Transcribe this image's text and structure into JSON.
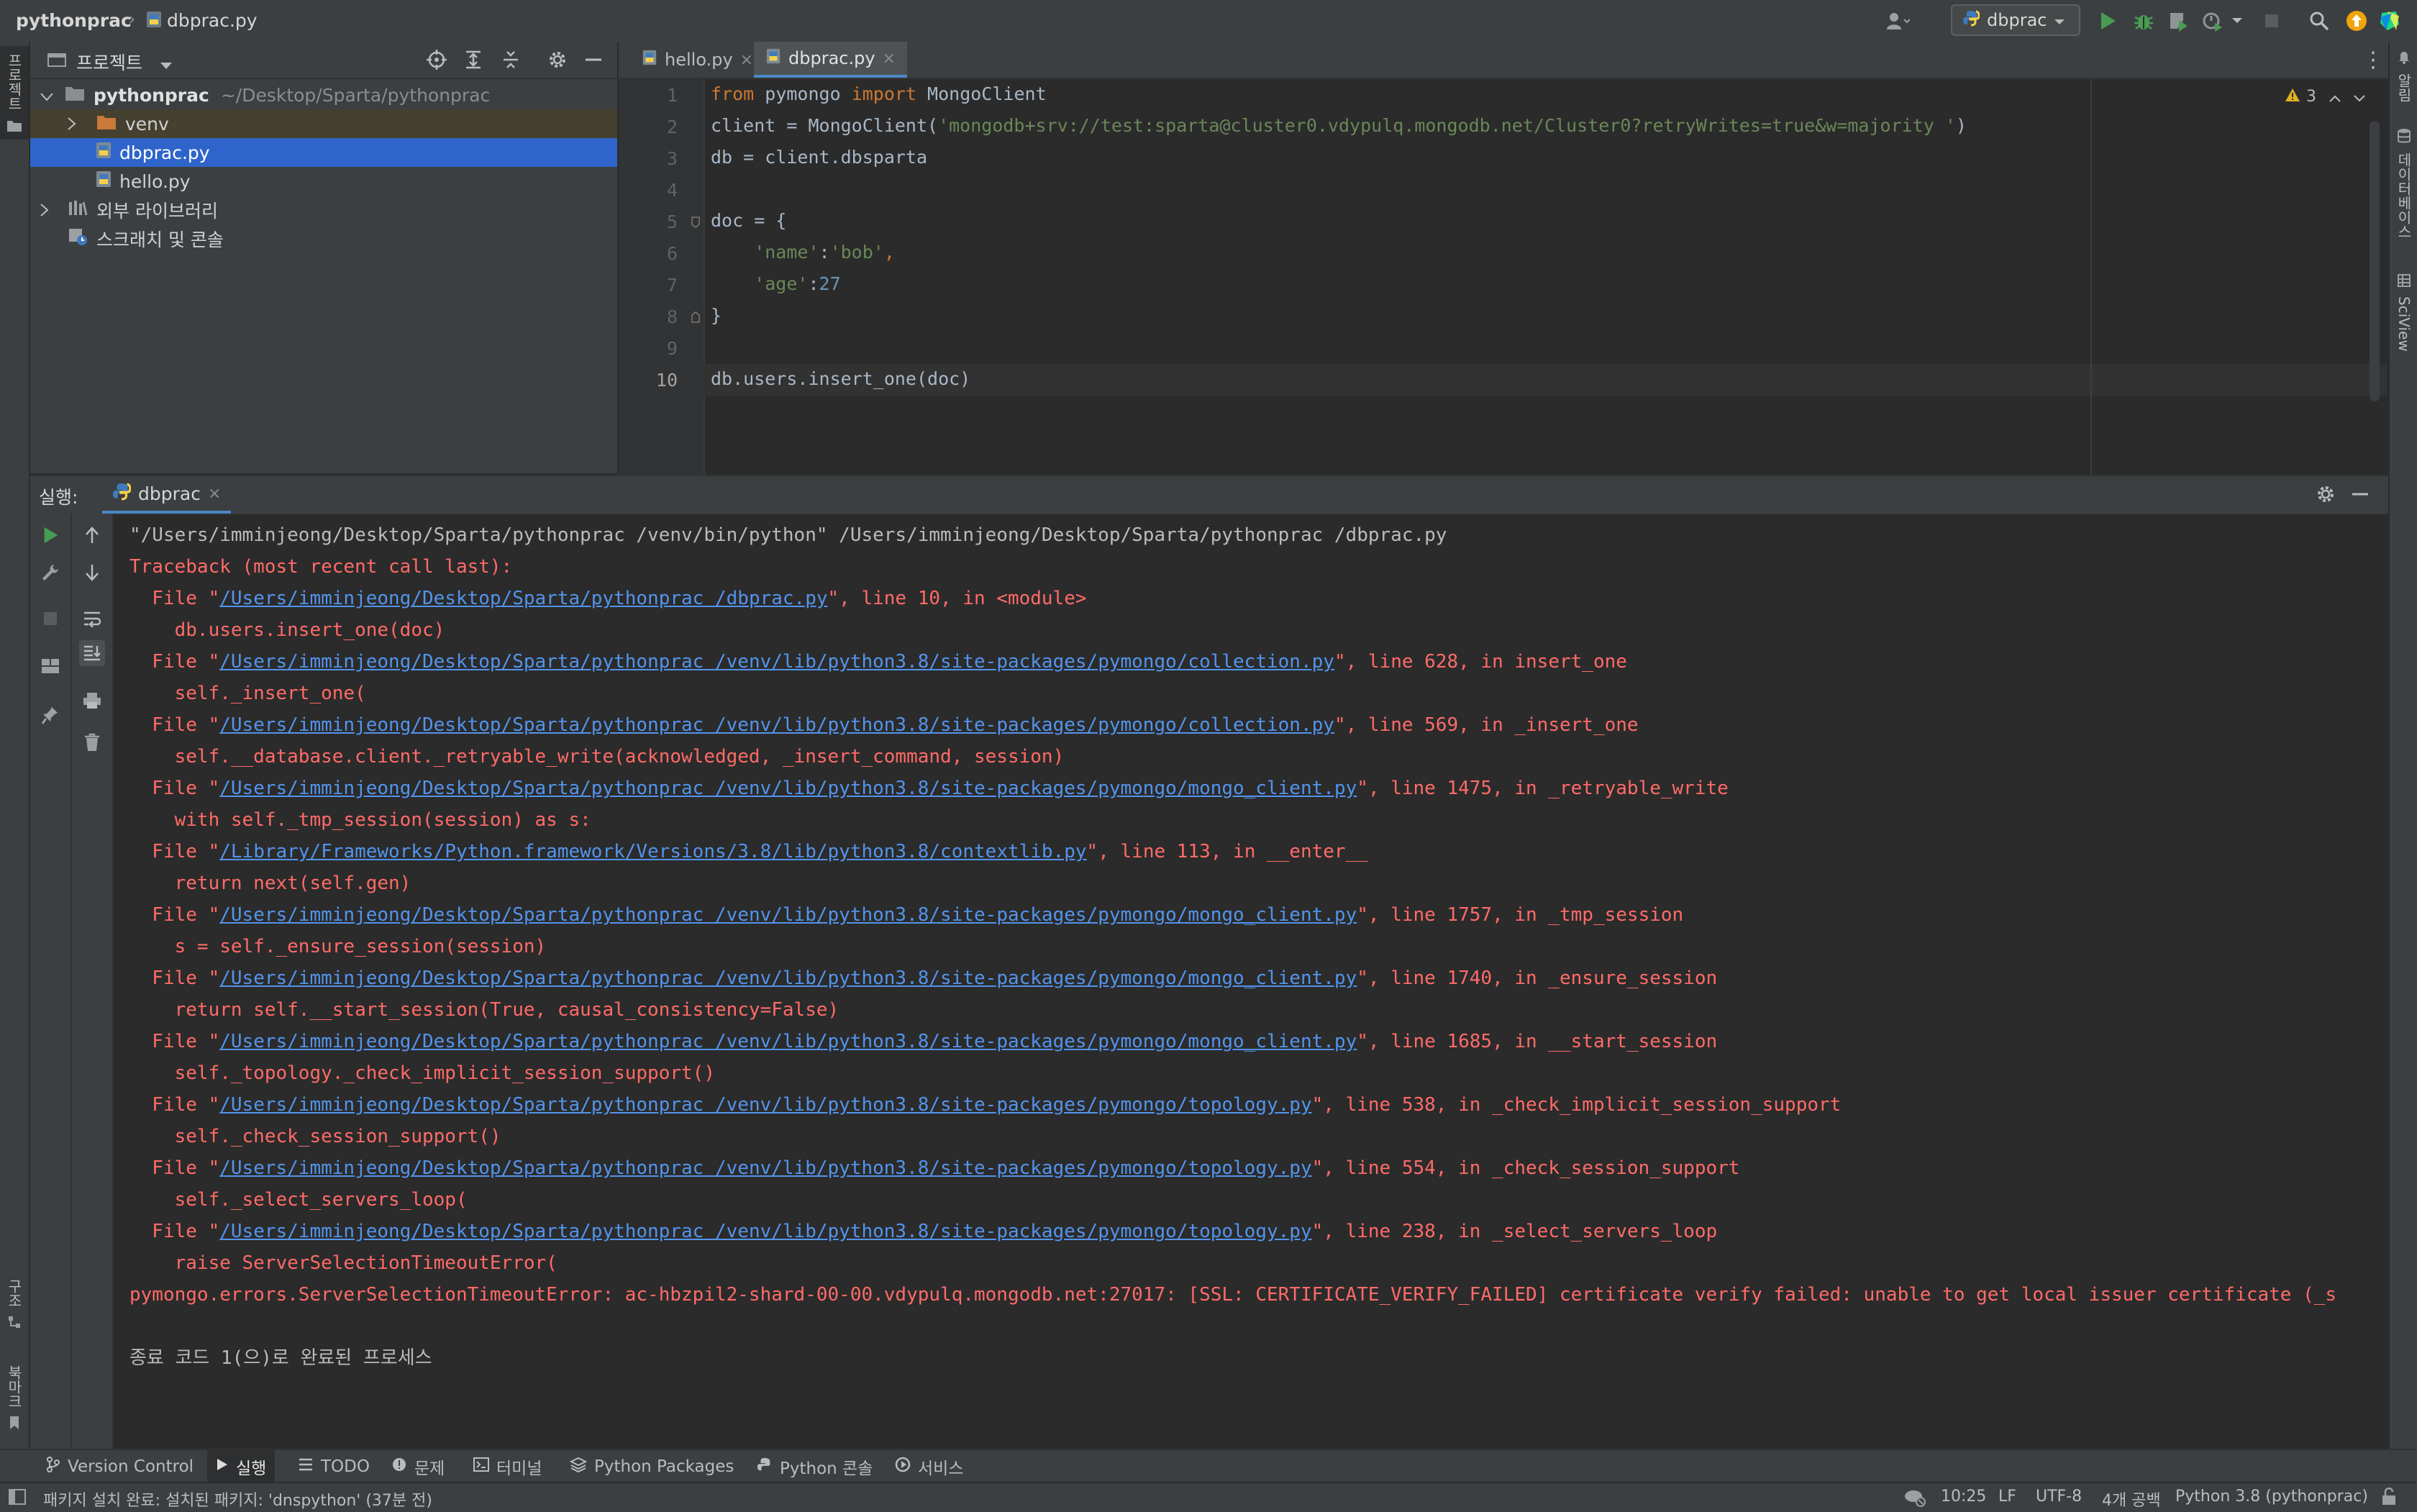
{
  "titlebar": {
    "project": "pythonprac",
    "separator": "›",
    "file": "dbprac.py",
    "run_config": "dbprac"
  },
  "left_strip": {
    "project_tab": "프로젝트",
    "structure_tab": "구조",
    "bookmarks_tab": "북마크"
  },
  "right_strip": {
    "notifications_tab": "알림",
    "database_tab": "데이터베이스",
    "sciview_tab": "SciView"
  },
  "project_panel": {
    "title": "프로젝트",
    "tree": [
      {
        "label": "pythonprac",
        "path": "~/Desktop/Sparta/pythonprac",
        "kind": "folder-open"
      },
      {
        "label": "venv",
        "kind": "folder-collapsed"
      },
      {
        "label": "dbprac.py",
        "kind": "file-selected"
      },
      {
        "label": "hello.py",
        "kind": "file"
      },
      {
        "label": "외부 라이브러리",
        "kind": "libraries"
      },
      {
        "label": "스크래치 및 콘솔",
        "kind": "scratches"
      }
    ]
  },
  "editor": {
    "tabs": [
      {
        "label": "hello.py",
        "active": false
      },
      {
        "label": "dbprac.py",
        "active": true
      }
    ],
    "warning_count": "3",
    "line_numbers": [
      "1",
      "2",
      "3",
      "4",
      "5",
      "6",
      "7",
      "8",
      "9",
      "10"
    ],
    "code": {
      "l1_kw1": "from",
      "l1_mod": " pymongo ",
      "l1_kw2": "import",
      "l1_name": " MongoClient",
      "l2_pre": "client = MongoClient(",
      "l2_str": "'mongodb+srv://test:sparta@cluster0.vdypulq.mongodb.net/Cluster0?retryWrites=true&w=majority '",
      "l2_post": ")",
      "l3": "db = client.dbsparta",
      "l5": "doc = {",
      "l6_key": "    'name'",
      "l6_colon": ":",
      "l6_val": "'bob'",
      "l6_comma": ",",
      "l7_key": "    'age'",
      "l7_colon": ":",
      "l7_val": "27",
      "l8": "}",
      "l10": "db.users.insert_one(doc)"
    }
  },
  "run_panel": {
    "label": "실행:",
    "tab": "dbprac",
    "console": [
      {
        "type": "plain",
        "text": "\"/Users/imminjeong/Desktop/Sparta/pythonprac /venv/bin/python\" /Users/imminjeong/Desktop/Sparta/pythonprac /dbprac.py"
      },
      {
        "type": "err",
        "text": "Traceback (most recent call last):"
      },
      {
        "type": "file",
        "pre": "  File \"",
        "link": "/Users/imminjeong/Desktop/Sparta/pythonprac /dbprac.py",
        "post": "\", line 10, in <module>"
      },
      {
        "type": "err",
        "text": "    db.users.insert_one(doc)"
      },
      {
        "type": "file",
        "pre": "  File \"",
        "link": "/Users/imminjeong/Desktop/Sparta/pythonprac /venv/lib/python3.8/site-packages/pymongo/collection.py",
        "post": "\", line 628, in insert_one"
      },
      {
        "type": "err",
        "text": "    self._insert_one("
      },
      {
        "type": "file",
        "pre": "  File \"",
        "link": "/Users/imminjeong/Desktop/Sparta/pythonprac /venv/lib/python3.8/site-packages/pymongo/collection.py",
        "post": "\", line 569, in _insert_one"
      },
      {
        "type": "err",
        "text": "    self.__database.client._retryable_write(acknowledged, _insert_command, session)"
      },
      {
        "type": "file",
        "pre": "  File \"",
        "link": "/Users/imminjeong/Desktop/Sparta/pythonprac /venv/lib/python3.8/site-packages/pymongo/mongo_client.py",
        "post": "\", line 1475, in _retryable_write"
      },
      {
        "type": "err",
        "text": "    with self._tmp_session(session) as s:"
      },
      {
        "type": "file",
        "pre": "  File \"",
        "link": "/Library/Frameworks/Python.framework/Versions/3.8/lib/python3.8/contextlib.py",
        "post": "\", line 113, in __enter__"
      },
      {
        "type": "err",
        "text": "    return next(self.gen)"
      },
      {
        "type": "file",
        "pre": "  File \"",
        "link": "/Users/imminjeong/Desktop/Sparta/pythonprac /venv/lib/python3.8/site-packages/pymongo/mongo_client.py",
        "post": "\", line 1757, in _tmp_session"
      },
      {
        "type": "err",
        "text": "    s = self._ensure_session(session)"
      },
      {
        "type": "file",
        "pre": "  File \"",
        "link": "/Users/imminjeong/Desktop/Sparta/pythonprac /venv/lib/python3.8/site-packages/pymongo/mongo_client.py",
        "post": "\", line 1740, in _ensure_session"
      },
      {
        "type": "err",
        "text": "    return self.__start_session(True, causal_consistency=False)"
      },
      {
        "type": "file",
        "pre": "  File \"",
        "link": "/Users/imminjeong/Desktop/Sparta/pythonprac /venv/lib/python3.8/site-packages/pymongo/mongo_client.py",
        "post": "\", line 1685, in __start_session"
      },
      {
        "type": "err",
        "text": "    self._topology._check_implicit_session_support()"
      },
      {
        "type": "file",
        "pre": "  File \"",
        "link": "/Users/imminjeong/Desktop/Sparta/pythonprac /venv/lib/python3.8/site-packages/pymongo/topology.py",
        "post": "\", line 538, in _check_implicit_session_support"
      },
      {
        "type": "err",
        "text": "    self._check_session_support()"
      },
      {
        "type": "file",
        "pre": "  File \"",
        "link": "/Users/imminjeong/Desktop/Sparta/pythonprac /venv/lib/python3.8/site-packages/pymongo/topology.py",
        "post": "\", line 554, in _check_session_support"
      },
      {
        "type": "err",
        "text": "    self._select_servers_loop("
      },
      {
        "type": "file",
        "pre": "  File \"",
        "link": "/Users/imminjeong/Desktop/Sparta/pythonprac /venv/lib/python3.8/site-packages/pymongo/topology.py",
        "post": "\", line 238, in _select_servers_loop"
      },
      {
        "type": "err",
        "text": "    raise ServerSelectionTimeoutError("
      },
      {
        "type": "err",
        "text": "pymongo.errors.ServerSelectionTimeoutError: ac-hbzpil2-shard-00-00.vdypulq.mongodb.net:27017: [SSL: CERTIFICATE_VERIFY_FAILED] certificate verify failed: unable to get local issuer certificate (_s"
      },
      {
        "type": "plain",
        "text": ""
      },
      {
        "type": "plain",
        "text": "종료 코드 1(으)로 완료된 프로세스"
      }
    ]
  },
  "bottom_tools": [
    {
      "label": "Version Control",
      "icon": "branch-icon"
    },
    {
      "label": "실행",
      "icon": "play-icon"
    },
    {
      "label": "TODO",
      "icon": "list-icon"
    },
    {
      "label": "문제",
      "icon": "problem-icon"
    },
    {
      "label": "터미널",
      "icon": "terminal-icon"
    },
    {
      "label": "Python Packages",
      "icon": "layers-icon"
    },
    {
      "label": "Python 콘솔",
      "icon": "python-icon"
    },
    {
      "label": "서비스",
      "icon": "services-icon"
    }
  ],
  "status_bar": {
    "message": "패키지 설치 완료: 설치된 패키지: 'dnspython' (37분 전)",
    "position": "10:25",
    "line_sep": "LF",
    "encoding": "UTF-8",
    "indent": "4개 공백",
    "interpreter": "Python 3.8 (pythonprac)"
  },
  "colors": {
    "error": "#ff6b68",
    "link": "#5394ec",
    "selection": "#2f65ca",
    "run_green": "#499c54"
  }
}
